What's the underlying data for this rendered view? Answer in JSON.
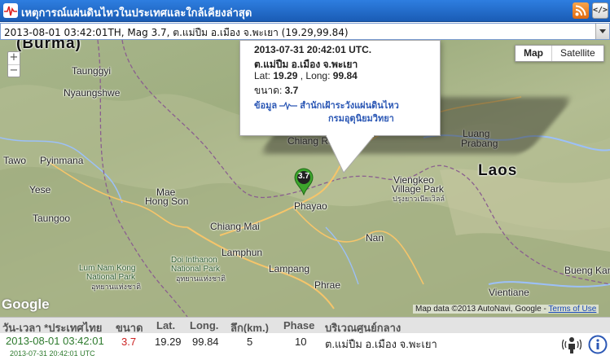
{
  "header": {
    "title": "เหตุการณ์แผ่นดินไหวในประเทศและใกล้เคียงล่าสุด",
    "icons": [
      "earthquake-logo-icon",
      "rss-icon",
      "embed-code-icon"
    ],
    "embed_label": "</>"
  },
  "event_select": {
    "selected": "2013-08-01 03:42:01TH, Mag 3.7, ต.แม่ปืม อ.เมือง จ.พะเยา (19.29,99.84)"
  },
  "map": {
    "zoom": {
      "in": "+",
      "out": "−"
    },
    "type_buttons": {
      "map": "Map",
      "satellite": "Satellite"
    },
    "labels": {
      "burma": "(Burma)",
      "taunggyi": "Taunggyi",
      "nyaungshwe": "Nyaungshwe",
      "tawo": "Tawo",
      "pyinmana": "Pyinmana",
      "yese": "Yese",
      "taungoo": "Taungoo",
      "mae_hong_son_1": "Mae",
      "mae_hong_son_2": "Hong Son",
      "chiang_mai": "Chiang Mai",
      "chiang_rai": "Chiang Rai",
      "phayao": "Phayao",
      "lamphun": "Lamphun",
      "lampang": "Lampang",
      "phrae": "Phrae",
      "nan": "Nan",
      "laos": "Laos",
      "luang_1": "Luang",
      "luang_2": "Prabang",
      "viengkeo_1": "Viengkeo",
      "viengkeo_2": "Village Park",
      "viengkeo_thai": "ปรุงยาวเนียเวิลล์",
      "doi_1": "Doi Inthanon",
      "doi_2": "National Park",
      "doi_thai": "อุทยานแห่งชาติ",
      "lum_1": "Lum Nam Kong",
      "lum_2": "National Park",
      "lum_thai": "อุทยานแห่งชาติ",
      "bueng_kan": "Bueng Kan",
      "vientiane": "Vientiane"
    },
    "marker_value": "3.7",
    "google": "Google",
    "attribution": "Map data ©2013 AutoNavi, Google -",
    "terms": "Terms of Use",
    "colors": {
      "water": "#9cc0f9",
      "marker": "#3da52c",
      "road": "#f6c56a"
    }
  },
  "infowindow": {
    "datetime_utc": "2013-07-31 20:42:01 UTC.",
    "location": "ต.แม่ปืม อ.เมือง จ.พะเยา",
    "lat_label": "Lat: ",
    "lat_value": "19.29",
    "long_label": " , Long: ",
    "long_value": "99.84",
    "mag_label": "ขนาด: ",
    "mag_value": "3.7",
    "source_label": "ข้อมูล",
    "source_org_1": "สำนักเฝ้าระวังแผ่นดินไหว",
    "source_org_2": "กรมอุตุนิยมวิทยา"
  },
  "table": {
    "headers": {
      "datetime": "วัน-เวลา *ประเทศไทย",
      "mag": "ขนาด",
      "lat": "Lat.",
      "long": "Long.",
      "depth": "ลึก(km.)",
      "phase": "Phase",
      "area": "บริเวณศูนย์กลาง"
    },
    "rows": [
      {
        "datetime_th": "2013-08-01 03:42:01",
        "datetime_utc": "2013-07-31 20:42:01 UTC",
        "mag": "3.7",
        "lat": "19.29",
        "long": "99.84",
        "depth": "5",
        "phase": "10",
        "area": "ต.แม่ปืม อ.เมือง จ.พะเยา",
        "icons": [
          "felt-report-icon",
          "info-icon"
        ]
      }
    ]
  }
}
